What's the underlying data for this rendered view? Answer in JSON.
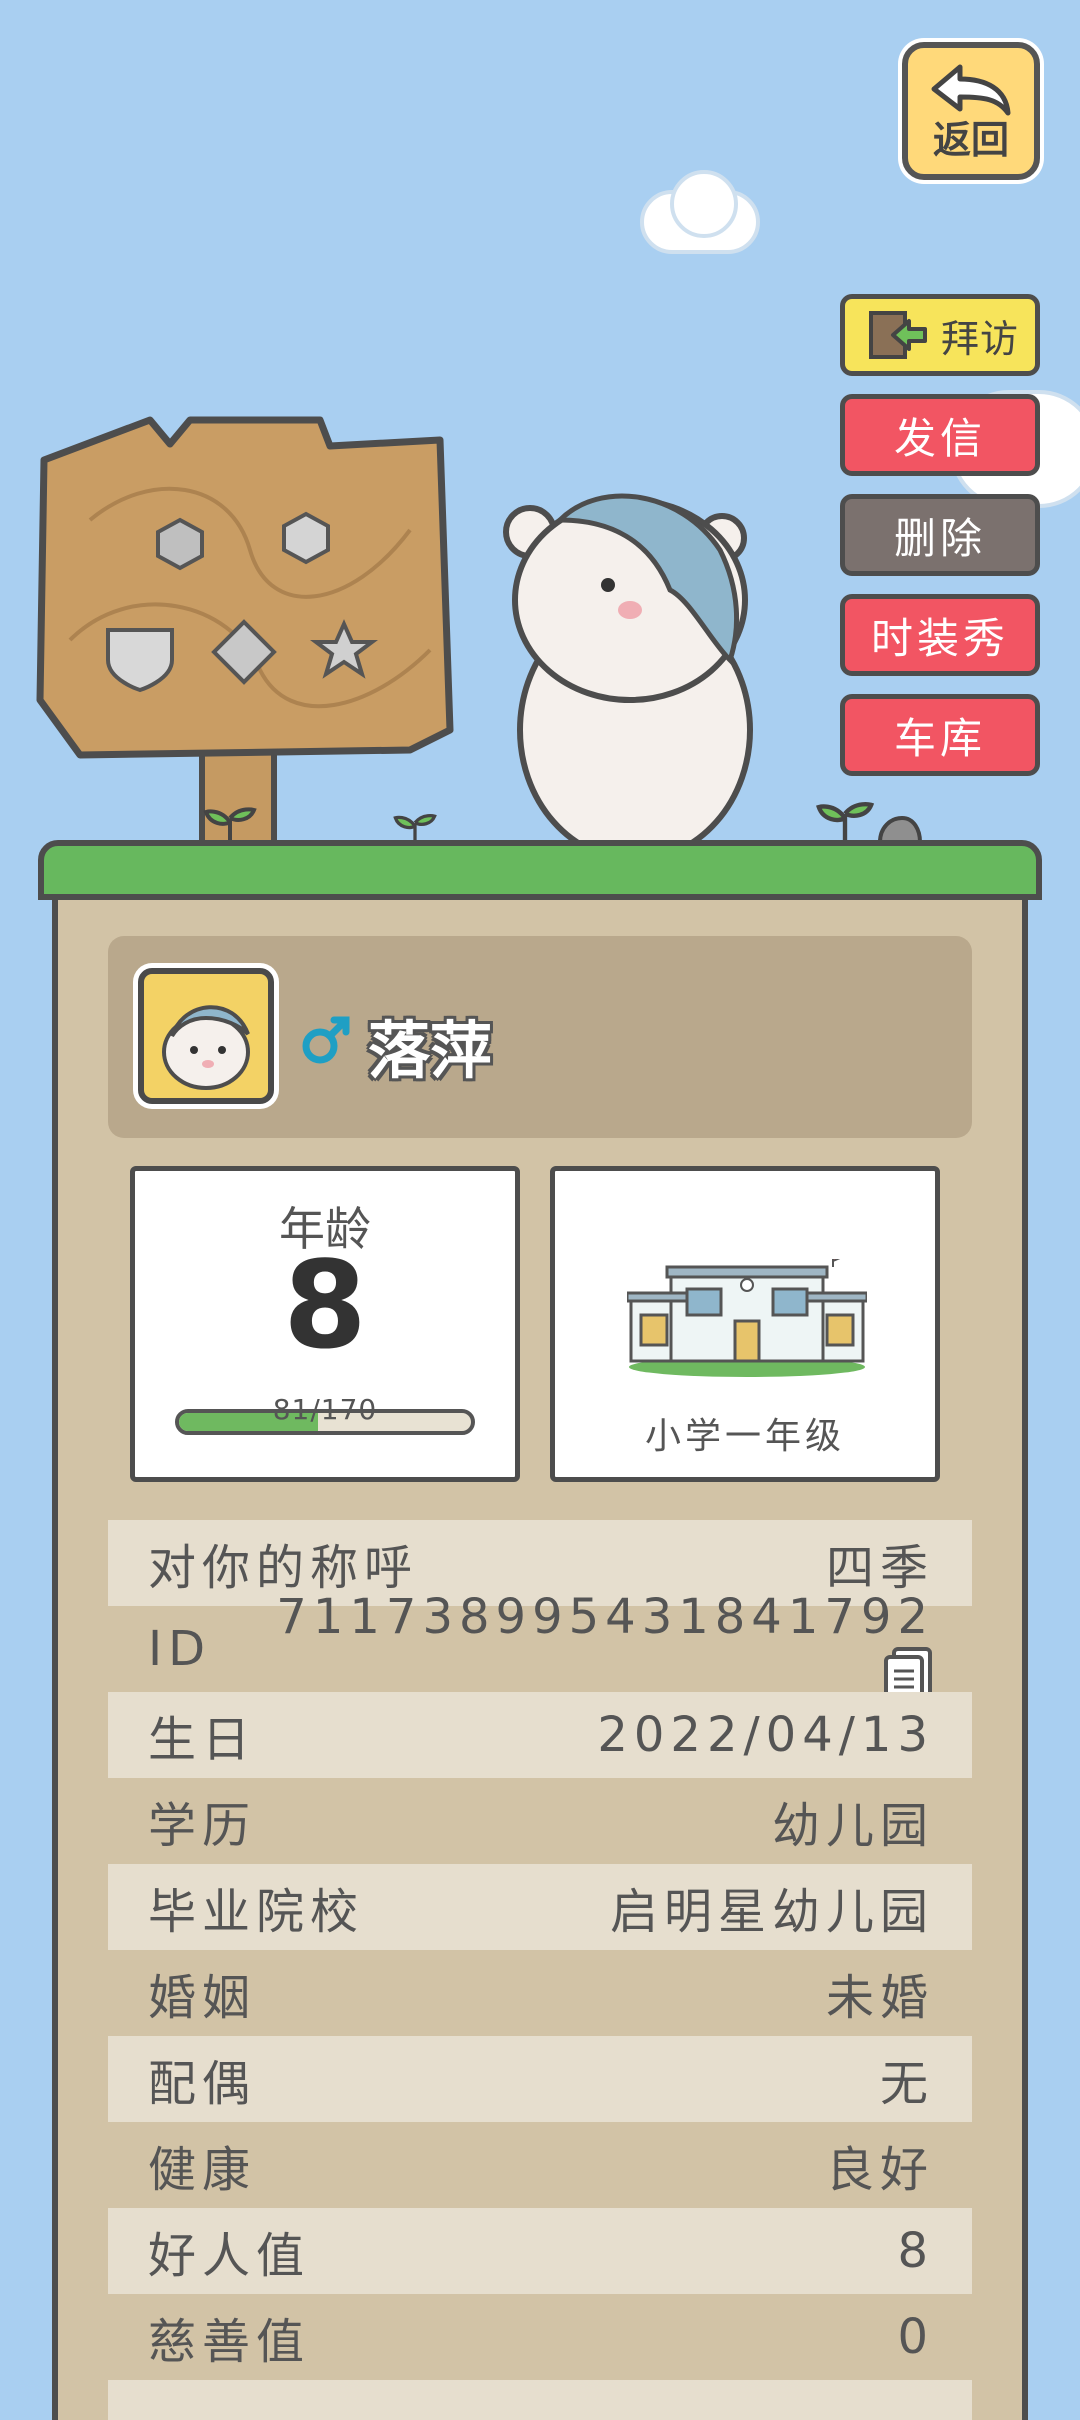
{
  "back_button": {
    "label": "返回"
  },
  "actions": [
    {
      "key": "visit",
      "label": "拜访"
    },
    {
      "key": "mail",
      "label": "发信"
    },
    {
      "key": "delete",
      "label": "删除"
    },
    {
      "key": "fashion",
      "label": "时装秀"
    },
    {
      "key": "garage",
      "label": "车库"
    }
  ],
  "profile": {
    "gender_icon": "male-icon",
    "name": "落萍"
  },
  "age_card": {
    "title": "年龄",
    "value": "8",
    "progress_text": "81/170",
    "progress_fraction": 0.476
  },
  "school_card": {
    "label": "小学一年级"
  },
  "info_rows": [
    {
      "label": "对你的称呼",
      "value": "四季"
    },
    {
      "label": "ID",
      "value": "7117389954318417​92"
    },
    {
      "label": "生日",
      "value": "2022/04/13"
    },
    {
      "label": "学历",
      "value": "幼儿园"
    },
    {
      "label": "毕业院校",
      "value": "启明星幼儿园"
    },
    {
      "label": "婚姻",
      "value": "未婚"
    },
    {
      "label": "配偶",
      "value": "无"
    },
    {
      "label": "健康",
      "value": "良好"
    },
    {
      "label": "好人值",
      "value": "8"
    },
    {
      "label": "慈善值",
      "value": "0"
    }
  ],
  "colors": {
    "sky": "#a9cff1",
    "grass": "#67b85e",
    "panel": "#d2c3a6",
    "button_red": "#f25563",
    "button_yellow": "#f7e45b",
    "button_grey": "#7b716e"
  }
}
